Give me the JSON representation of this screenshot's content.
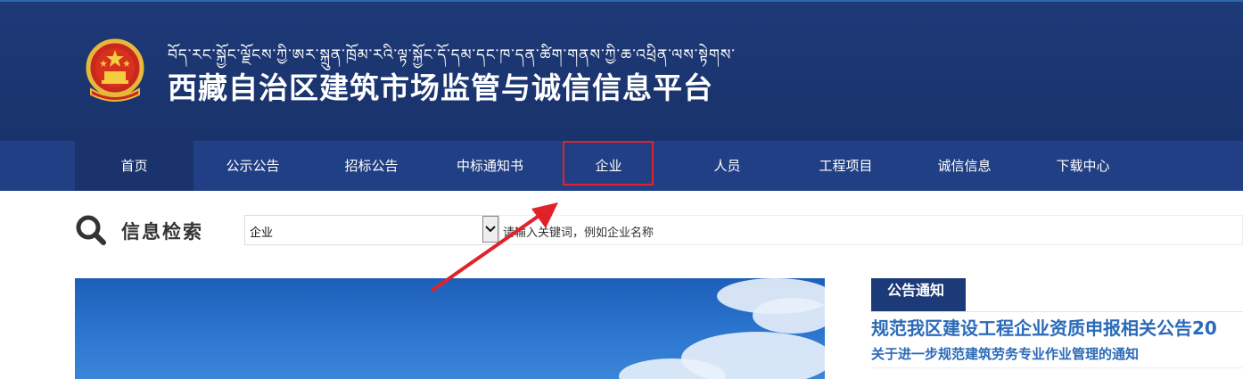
{
  "header": {
    "tibetan_title": "བོད་རང་སྐྱོང་ལྗོངས་ཀྱི་ཨར་སྐྲུན་ཁྲོམ་རའི་ལྟ་སྐྱོང་དོ་དམ་དང་ཁ་དན་ཚིག་གནས་ཀྱི་ཆ་འཕྲིན་ལས་སྟེགས་",
    "site_title": "西藏自治区建筑市场监管与诚信信息平台"
  },
  "nav": {
    "items": [
      {
        "label": "首页"
      },
      {
        "label": "公示公告"
      },
      {
        "label": "招标公告"
      },
      {
        "label": "中标通知书"
      },
      {
        "label": "企业"
      },
      {
        "label": "人员"
      },
      {
        "label": "工程项目"
      },
      {
        "label": "诚信信息"
      },
      {
        "label": "下载中心"
      }
    ]
  },
  "search": {
    "label": "信息检索",
    "select_value": "企业",
    "placeholder": "请输入关键词，例如企业名称"
  },
  "notice": {
    "tab_label": "公告通知",
    "headline": "规范我区建设工程企业资质申报相关公告20",
    "sub": "关于进一步规范建筑劳务专业作业管理的通知"
  },
  "colors": {
    "header_bg": "#1b3570",
    "nav_bg": "#213f84",
    "highlight": "#e0222b",
    "link": "#2a6ab8"
  }
}
